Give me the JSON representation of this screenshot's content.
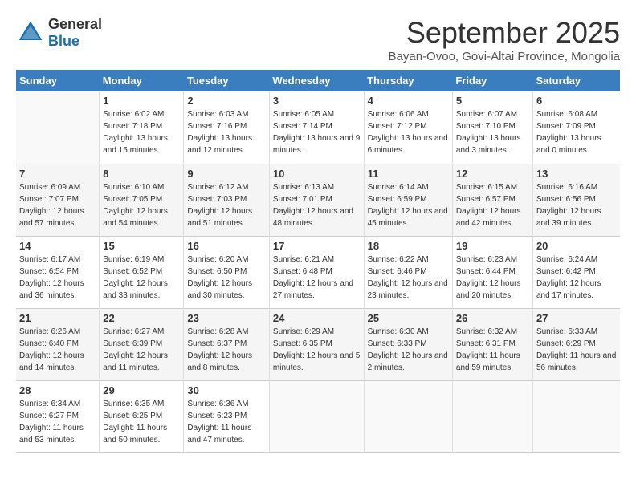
{
  "header": {
    "logo_general": "General",
    "logo_blue": "Blue",
    "month_title": "September 2025",
    "location": "Bayan-Ovoo, Govi-Altai Province, Mongolia"
  },
  "weekdays": [
    "Sunday",
    "Monday",
    "Tuesday",
    "Wednesday",
    "Thursday",
    "Friday",
    "Saturday"
  ],
  "weeks": [
    [
      {
        "day": "",
        "sunrise": "",
        "sunset": "",
        "daylight": ""
      },
      {
        "day": "1",
        "sunrise": "Sunrise: 6:02 AM",
        "sunset": "Sunset: 7:18 PM",
        "daylight": "Daylight: 13 hours and 15 minutes."
      },
      {
        "day": "2",
        "sunrise": "Sunrise: 6:03 AM",
        "sunset": "Sunset: 7:16 PM",
        "daylight": "Daylight: 13 hours and 12 minutes."
      },
      {
        "day": "3",
        "sunrise": "Sunrise: 6:05 AM",
        "sunset": "Sunset: 7:14 PM",
        "daylight": "Daylight: 13 hours and 9 minutes."
      },
      {
        "day": "4",
        "sunrise": "Sunrise: 6:06 AM",
        "sunset": "Sunset: 7:12 PM",
        "daylight": "Daylight: 13 hours and 6 minutes."
      },
      {
        "day": "5",
        "sunrise": "Sunrise: 6:07 AM",
        "sunset": "Sunset: 7:10 PM",
        "daylight": "Daylight: 13 hours and 3 minutes."
      },
      {
        "day": "6",
        "sunrise": "Sunrise: 6:08 AM",
        "sunset": "Sunset: 7:09 PM",
        "daylight": "Daylight: 13 hours and 0 minutes."
      }
    ],
    [
      {
        "day": "7",
        "sunrise": "Sunrise: 6:09 AM",
        "sunset": "Sunset: 7:07 PM",
        "daylight": "Daylight: 12 hours and 57 minutes."
      },
      {
        "day": "8",
        "sunrise": "Sunrise: 6:10 AM",
        "sunset": "Sunset: 7:05 PM",
        "daylight": "Daylight: 12 hours and 54 minutes."
      },
      {
        "day": "9",
        "sunrise": "Sunrise: 6:12 AM",
        "sunset": "Sunset: 7:03 PM",
        "daylight": "Daylight: 12 hours and 51 minutes."
      },
      {
        "day": "10",
        "sunrise": "Sunrise: 6:13 AM",
        "sunset": "Sunset: 7:01 PM",
        "daylight": "Daylight: 12 hours and 48 minutes."
      },
      {
        "day": "11",
        "sunrise": "Sunrise: 6:14 AM",
        "sunset": "Sunset: 6:59 PM",
        "daylight": "Daylight: 12 hours and 45 minutes."
      },
      {
        "day": "12",
        "sunrise": "Sunrise: 6:15 AM",
        "sunset": "Sunset: 6:57 PM",
        "daylight": "Daylight: 12 hours and 42 minutes."
      },
      {
        "day": "13",
        "sunrise": "Sunrise: 6:16 AM",
        "sunset": "Sunset: 6:56 PM",
        "daylight": "Daylight: 12 hours and 39 minutes."
      }
    ],
    [
      {
        "day": "14",
        "sunrise": "Sunrise: 6:17 AM",
        "sunset": "Sunset: 6:54 PM",
        "daylight": "Daylight: 12 hours and 36 minutes."
      },
      {
        "day": "15",
        "sunrise": "Sunrise: 6:19 AM",
        "sunset": "Sunset: 6:52 PM",
        "daylight": "Daylight: 12 hours and 33 minutes."
      },
      {
        "day": "16",
        "sunrise": "Sunrise: 6:20 AM",
        "sunset": "Sunset: 6:50 PM",
        "daylight": "Daylight: 12 hours and 30 minutes."
      },
      {
        "day": "17",
        "sunrise": "Sunrise: 6:21 AM",
        "sunset": "Sunset: 6:48 PM",
        "daylight": "Daylight: 12 hours and 27 minutes."
      },
      {
        "day": "18",
        "sunrise": "Sunrise: 6:22 AM",
        "sunset": "Sunset: 6:46 PM",
        "daylight": "Daylight: 12 hours and 23 minutes."
      },
      {
        "day": "19",
        "sunrise": "Sunrise: 6:23 AM",
        "sunset": "Sunset: 6:44 PM",
        "daylight": "Daylight: 12 hours and 20 minutes."
      },
      {
        "day": "20",
        "sunrise": "Sunrise: 6:24 AM",
        "sunset": "Sunset: 6:42 PM",
        "daylight": "Daylight: 12 hours and 17 minutes."
      }
    ],
    [
      {
        "day": "21",
        "sunrise": "Sunrise: 6:26 AM",
        "sunset": "Sunset: 6:40 PM",
        "daylight": "Daylight: 12 hours and 14 minutes."
      },
      {
        "day": "22",
        "sunrise": "Sunrise: 6:27 AM",
        "sunset": "Sunset: 6:39 PM",
        "daylight": "Daylight: 12 hours and 11 minutes."
      },
      {
        "day": "23",
        "sunrise": "Sunrise: 6:28 AM",
        "sunset": "Sunset: 6:37 PM",
        "daylight": "Daylight: 12 hours and 8 minutes."
      },
      {
        "day": "24",
        "sunrise": "Sunrise: 6:29 AM",
        "sunset": "Sunset: 6:35 PM",
        "daylight": "Daylight: 12 hours and 5 minutes."
      },
      {
        "day": "25",
        "sunrise": "Sunrise: 6:30 AM",
        "sunset": "Sunset: 6:33 PM",
        "daylight": "Daylight: 12 hours and 2 minutes."
      },
      {
        "day": "26",
        "sunrise": "Sunrise: 6:32 AM",
        "sunset": "Sunset: 6:31 PM",
        "daylight": "Daylight: 11 hours and 59 minutes."
      },
      {
        "day": "27",
        "sunrise": "Sunrise: 6:33 AM",
        "sunset": "Sunset: 6:29 PM",
        "daylight": "Daylight: 11 hours and 56 minutes."
      }
    ],
    [
      {
        "day": "28",
        "sunrise": "Sunrise: 6:34 AM",
        "sunset": "Sunset: 6:27 PM",
        "daylight": "Daylight: 11 hours and 53 minutes."
      },
      {
        "day": "29",
        "sunrise": "Sunrise: 6:35 AM",
        "sunset": "Sunset: 6:25 PM",
        "daylight": "Daylight: 11 hours and 50 minutes."
      },
      {
        "day": "30",
        "sunrise": "Sunrise: 6:36 AM",
        "sunset": "Sunset: 6:23 PM",
        "daylight": "Daylight: 11 hours and 47 minutes."
      },
      {
        "day": "",
        "sunrise": "",
        "sunset": "",
        "daylight": ""
      },
      {
        "day": "",
        "sunrise": "",
        "sunset": "",
        "daylight": ""
      },
      {
        "day": "",
        "sunrise": "",
        "sunset": "",
        "daylight": ""
      },
      {
        "day": "",
        "sunrise": "",
        "sunset": "",
        "daylight": ""
      }
    ]
  ]
}
